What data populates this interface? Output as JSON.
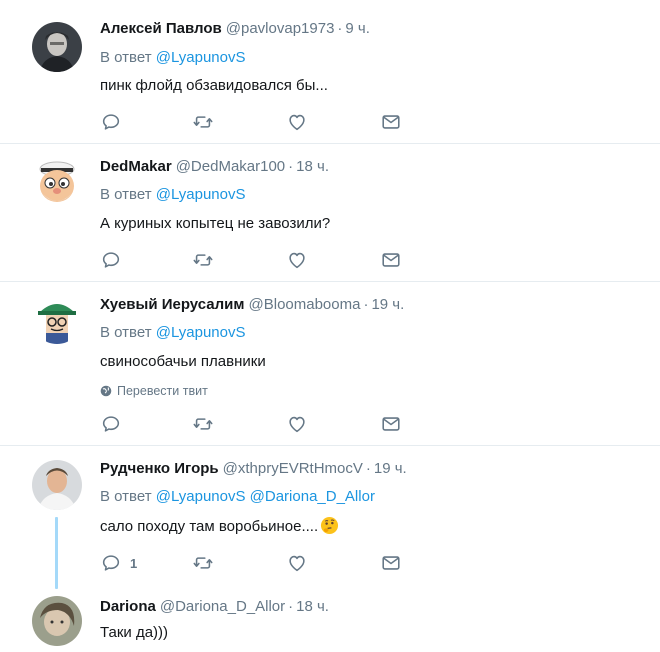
{
  "tweets": [
    {
      "name": "Алексей Павлов",
      "handle": "@pavlovap1973",
      "dot": "·",
      "time": "9 ч.",
      "reply_prefix": "В ответ",
      "reply_to": [
        "@LyapunovS"
      ],
      "text": "пинк флойд обзавидовался бы...",
      "reply_count": "",
      "avatar_bg": "#2f3338"
    },
    {
      "name": "DedMakar",
      "handle": "@DedMakar100",
      "dot": "·",
      "time": "18 ч.",
      "reply_prefix": "В ответ",
      "reply_to": [
        "@LyapunovS"
      ],
      "text": "А куриных копытец  не завозили?",
      "reply_count": "",
      "avatar_bg": "#ffffff"
    },
    {
      "name": "Хуевый Иерусалим",
      "handle": "@Bloomabooma",
      "dot": "·",
      "time": "19 ч.",
      "reply_prefix": "В ответ",
      "reply_to": [
        "@LyapunovS"
      ],
      "text": "свинособачьи плавники",
      "translate": "Перевести твит",
      "reply_count": "",
      "avatar_bg": "#ffffff"
    },
    {
      "name": "Рудченко Игорь",
      "handle": "@xthpryEVRtHmocV",
      "dot": "·",
      "time": "19 ч.",
      "reply_prefix": "В ответ",
      "reply_to": [
        "@LyapunovS",
        "@Dariona_D_Allor"
      ],
      "text": "сало походу там воробьиное....",
      "emoji": "thinking-face",
      "reply_count": "1",
      "avatar_bg": "#c9ccd1"
    },
    {
      "name": "Dariona",
      "handle": "@Dariona_D_Allor",
      "dot": "·",
      "time": "18 ч.",
      "text": "Таки да)))",
      "avatar_bg": "#8a8f7a"
    }
  ],
  "icons": {
    "reply": "reply-icon",
    "retweet": "retweet-icon",
    "like": "heart-icon",
    "dm": "envelope-icon",
    "translate": "globe-icon"
  },
  "colors": {
    "link": "#1b95e0",
    "muted": "#657786",
    "thread_line": "#a4d9f9",
    "divider": "#e6ecf0"
  }
}
